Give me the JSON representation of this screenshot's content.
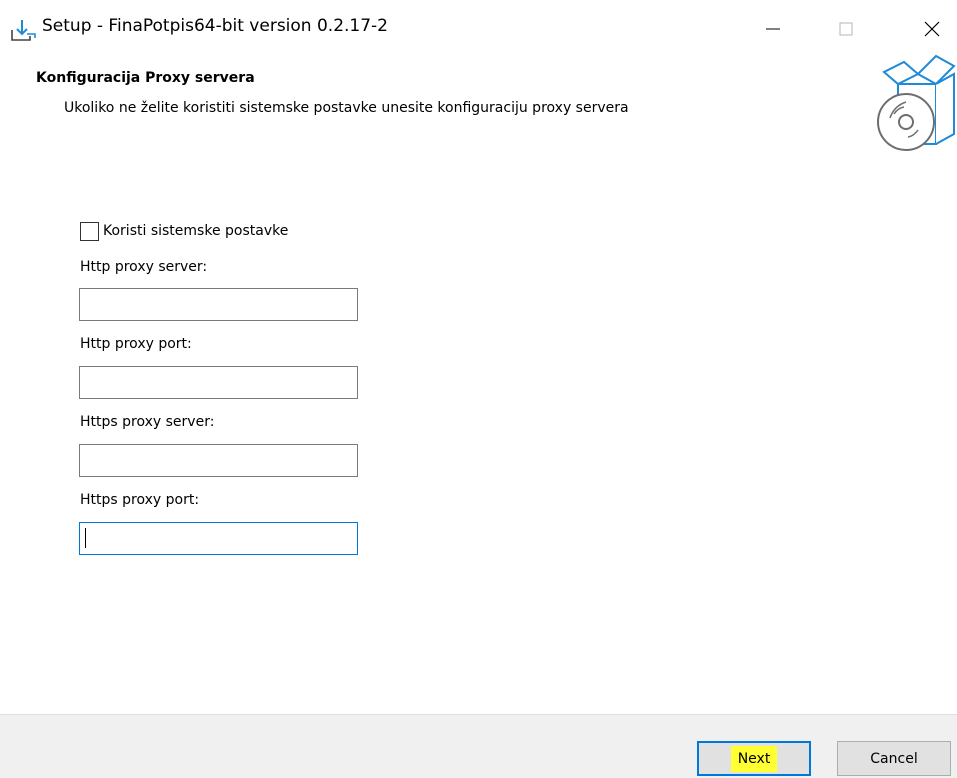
{
  "window": {
    "title": "Setup - FinaPotpis64-bit version 0.2.17-2"
  },
  "header": {
    "title": "Konfiguracija Proxy servera",
    "subtitle": "Ukoliko ne želite koristiti sistemske postavke unesite konfiguraciju proxy servera"
  },
  "form": {
    "use_system_label": "Koristi sistemske postavke",
    "use_system_checked": false,
    "http_server_label": "Http proxy server:",
    "http_server_value": "",
    "http_port_label": "Http proxy port:",
    "http_port_value": "",
    "https_server_label": "Https proxy server:",
    "https_server_value": "",
    "https_port_label": "Https proxy port:",
    "https_port_value": ""
  },
  "footer": {
    "next_label": "Next",
    "cancel_label": "Cancel"
  },
  "colors": {
    "accent": "#0078d7",
    "highlight": "#ffff33",
    "footer_bg": "#f0f0f0",
    "icon_blue": "#1f8ad8"
  },
  "icons": {
    "title": "installer-download-icon",
    "header_art": "software-box-disc-icon",
    "minimize": "minimize-icon",
    "maximize": "maximize-icon",
    "close": "close-icon"
  }
}
